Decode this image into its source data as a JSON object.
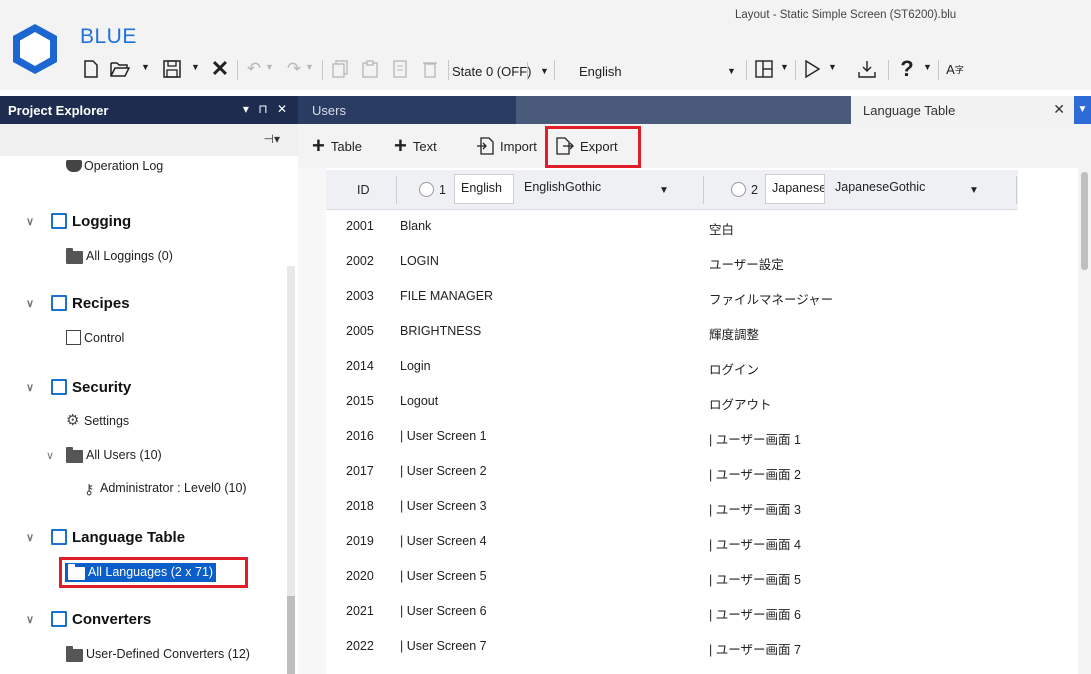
{
  "app": {
    "name": "BLUE",
    "window_title": "Layout - Static Simple Screen (ST6200).blu"
  },
  "toolbar": {
    "state_label": "State 0 (OFF)",
    "language_label": "English",
    "icons": [
      "new-file-icon",
      "open-icon",
      "save-icon",
      "close-icon",
      "undo-icon",
      "redo-icon",
      "copy-icon",
      "paste-icon",
      "duplicate-icon",
      "delete-icon",
      "layout-icon",
      "run-icon",
      "download-icon",
      "help-icon",
      "font-icon"
    ]
  },
  "explorer": {
    "title": "Project Explorer",
    "controls": "▾ ⊓ ✕",
    "pin_symbol": "⊣▾",
    "items": {
      "operation_log": "Operation Log",
      "logging": "Logging",
      "all_loggings": "All Loggings (0)",
      "recipes": "Recipes",
      "control": "Control",
      "security": "Security",
      "settings": "Settings",
      "all_users": "All Users (10)",
      "administrator": "Administrator : Level0 (10)",
      "language_table": "Language Table",
      "all_languages": "All Languages (2 x 71)",
      "converters": "Converters",
      "user_defined_converters": "User-Defined Converters (12)"
    }
  },
  "tabs": {
    "users": "Users",
    "language_table": "Language Table",
    "close_symbol": "✕"
  },
  "actions": {
    "table": "Table",
    "text": "Text",
    "import": "Import",
    "export": "Export"
  },
  "grid": {
    "id_header": "ID",
    "lang1": {
      "num": "1",
      "name": "English",
      "font": "EnglishGothic"
    },
    "lang2": {
      "num": "2",
      "name": "Japanese",
      "font": "JapaneseGothic"
    },
    "rows": [
      {
        "id": "2001",
        "en": "Blank",
        "ja": "空白"
      },
      {
        "id": "2002",
        "en": "LOGIN",
        "ja": "ユーザー設定"
      },
      {
        "id": "2003",
        "en": "FILE MANAGER",
        "ja": "ファイルマネージャー"
      },
      {
        "id": "2005",
        "en": "BRIGHTNESS",
        "ja": "輝度調整"
      },
      {
        "id": "2014",
        "en": "Login",
        "ja": "ログイン"
      },
      {
        "id": "2015",
        "en": "Logout",
        "ja": "ログアウト"
      },
      {
        "id": "2016",
        "en": "| User Screen 1",
        "ja": "| ユーザー画面 1"
      },
      {
        "id": "2017",
        "en": "| User Screen 2",
        "ja": "| ユーザー画面 2"
      },
      {
        "id": "2018",
        "en": "| User Screen 3",
        "ja": "| ユーザー画面 3"
      },
      {
        "id": "2019",
        "en": "| User Screen 4",
        "ja": "| ユーザー画面 4"
      },
      {
        "id": "2020",
        "en": "| User Screen 5",
        "ja": "| ユーザー画面 5"
      },
      {
        "id": "2021",
        "en": "| User Screen 6",
        "ja": "| ユーザー画面 6"
      },
      {
        "id": "2022",
        "en": "| User Screen 7",
        "ja": "| ユーザー画面 7"
      }
    ]
  },
  "colors": {
    "accent": "#1f72d8",
    "panel_header": "#1e2d4f",
    "selection": "#0a5ec9",
    "highlight_box": "#e11d2a"
  }
}
